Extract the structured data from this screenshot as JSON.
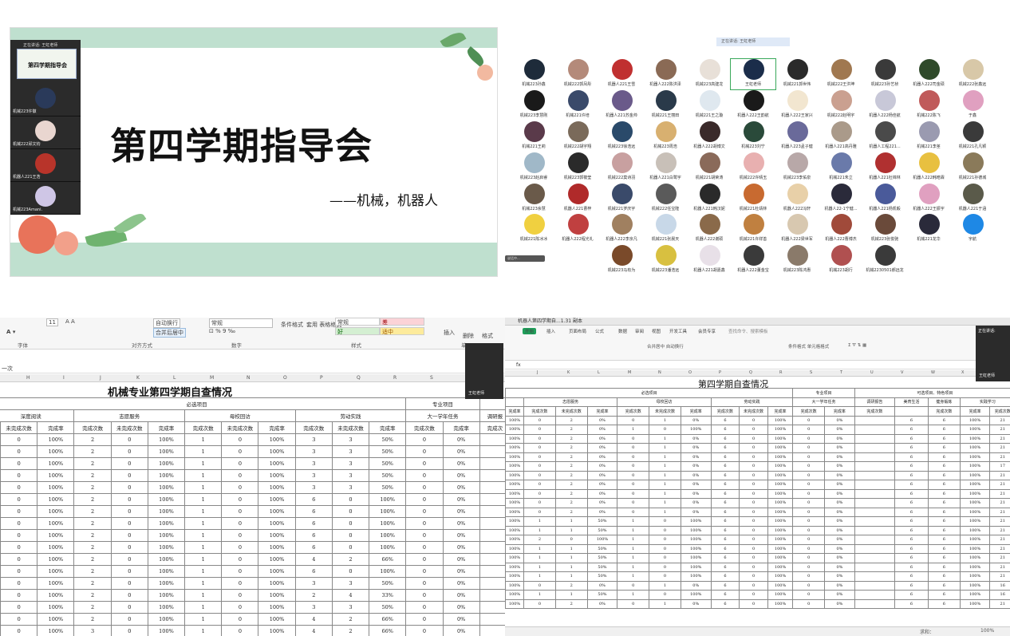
{
  "slide": {
    "title": "第四学期指导会",
    "subtitle": "——机械，机器人",
    "thumb_title": "第四学期指导会"
  },
  "video_strip": {
    "speaking_caption": "正在讲话: 王虹老师",
    "tiles": [
      {
        "name": "机械223许徽",
        "color": "#2a3a5a"
      },
      {
        "name": "机械222邱文钧",
        "color": "#e9d6d0"
      },
      {
        "name": "机器人221王浩",
        "color": "#b8342a"
      },
      {
        "name": "机械223Amani.",
        "color": "#cfc6e6"
      }
    ]
  },
  "gallery": {
    "header": "正在讲话: 王虹老师",
    "bottom_button": "说话中...",
    "participants": [
      {
        "name": "机械223孙鑫",
        "color": "#1e2b3a"
      },
      {
        "name": "机械222郭凤彤",
        "color": "#b48a7a"
      },
      {
        "name": "机器人221王雪",
        "color": "#c03030"
      },
      {
        "name": "机器人222陈洪泽",
        "color": "#8a6a55"
      },
      {
        "name": "机械223高建龙",
        "color": "#e8e0d8"
      },
      {
        "name": "王虹老师",
        "color": "#1b2d4a"
      },
      {
        "name": "机械221郭世伟",
        "color": "#2a2a2a"
      },
      {
        "name": "机械222王洪坤",
        "color": "#a07850"
      },
      {
        "name": "机械223孙艺桢",
        "color": "#3a3a3a"
      },
      {
        "name": "机器人222司金硕",
        "color": "#2f4a2a"
      },
      {
        "name": "机械222张鑫远",
        "color": "#d8c8a8"
      },
      {
        "name": "机械223李慧刚",
        "color": "#1a1a1a"
      },
      {
        "name": "机械221许培",
        "color": "#3a4a6a"
      },
      {
        "name": "机器人221苏金帅",
        "color": "#6a5a8a"
      },
      {
        "name": "机械221王丽田",
        "color": "#2a3a4a"
      },
      {
        "name": "机械221王之璇",
        "color": "#dfe8ef"
      },
      {
        "name": "机器人222王韵航",
        "color": "#1a1a1a"
      },
      {
        "name": "机器人222王家兴",
        "color": "#f2e6d0"
      },
      {
        "name": "机械222赵明宇",
        "color": "#caa090"
      },
      {
        "name": "机器人222杨佳航",
        "color": "#c8c8d8"
      },
      {
        "name": "机械222陈飞",
        "color": "#c05a5a"
      },
      {
        "name": "于鑫",
        "color": "#e0a0c0"
      },
      {
        "name": "机械221王莉",
        "color": "#5a3a4a"
      },
      {
        "name": "机械222胡宇翔",
        "color": "#7a6a5a"
      },
      {
        "name": "机械223徐浩远",
        "color": "#2a4a6a"
      },
      {
        "name": "机械223周浩",
        "color": "#d8b070"
      },
      {
        "name": "机器人222胡博文",
        "color": "#3a2a2a"
      },
      {
        "name": "机械223刘宁",
        "color": "#2a4a3a"
      },
      {
        "name": "机器人223孟子健",
        "color": "#6a6a9a"
      },
      {
        "name": "机器人221高丹雅",
        "color": "#aa9a8a"
      },
      {
        "name": "机器人工程221...",
        "color": "#4a4a4a"
      },
      {
        "name": "机械221李茎",
        "color": "#9a9ab0"
      },
      {
        "name": "机械221孔凡颖",
        "color": "#3a3a3a"
      },
      {
        "name": "机械223赵启睿",
        "color": "#a0b8c8"
      },
      {
        "name": "机械223郭筱莹",
        "color": "#2a2a2a"
      },
      {
        "name": "机械222莫诗羽",
        "color": "#c8a0a0"
      },
      {
        "name": "机器人221白鹭宇",
        "color": "#c8c0b8"
      },
      {
        "name": "机械221胡荣涛",
        "color": "#8a6a5a"
      },
      {
        "name": "机械222许晴玉",
        "color": "#e8b0b0"
      },
      {
        "name": "机械223李佑泉",
        "color": "#b8a8a8"
      },
      {
        "name": "机械221朱立",
        "color": "#6a7aaa"
      },
      {
        "name": "机器人221杜锦林",
        "color": "#b03030"
      },
      {
        "name": "机器人222韩皓霖",
        "color": "#e8c040"
      },
      {
        "name": "机械221孙德城",
        "color": "#8a7a5a"
      },
      {
        "name": "机械223余慧",
        "color": "#6a5a4a"
      },
      {
        "name": "机器人221曹梓",
        "color": "#b02a2a"
      },
      {
        "name": "机械221罗庆宇",
        "color": "#3a4a6a"
      },
      {
        "name": "机械222任宝隆",
        "color": "#5a5a5a"
      },
      {
        "name": "机器人221韩汉妮",
        "color": "#2a2a2a"
      },
      {
        "name": "机械221杜靖林",
        "color": "#c86a30"
      },
      {
        "name": "机器人222冯轩",
        "color": "#e8d0a8"
      },
      {
        "name": "机器人22-1宁健...",
        "color": "#2a2a3a"
      },
      {
        "name": "机器人221杨凯毅",
        "color": "#4a5a9a"
      },
      {
        "name": "机器人222王振宇",
        "color": "#e0a0c0"
      },
      {
        "name": "机器人221于涵",
        "color": "#5a5a4a"
      },
      {
        "name": "机械221陈冰冰",
        "color": "#f0d040"
      },
      {
        "name": "机器人222程光礼",
        "color": "#c04040"
      },
      {
        "name": "机器人222李京凡",
        "color": "#a08060"
      },
      {
        "name": "机械221张晨天",
        "color": "#c8d8e8"
      },
      {
        "name": "机器人222谢硕",
        "color": "#8a6a4a"
      },
      {
        "name": "机械221许祥善",
        "color": "#c08040"
      },
      {
        "name": "机器人222梁世军",
        "color": "#d8c8b0"
      },
      {
        "name": "机器人222曹博杰",
        "color": "#a04a3a"
      },
      {
        "name": "机械223张俊驰",
        "color": "#6a4a3a"
      },
      {
        "name": "机械221龙华",
        "color": "#2a2a3a"
      },
      {
        "name": "宇航",
        "color": "#1e88e5"
      },
      {
        "name": "机械223马有为",
        "color": "#7a4a2a"
      },
      {
        "name": "机械223潘浩远",
        "color": "#d8c040"
      },
      {
        "name": "机器人221胡嘉鑫",
        "color": "#e8e0e8"
      },
      {
        "name": "机器人222董金宝",
        "color": "#3a3a3a"
      },
      {
        "name": "机械223陈鸿惠",
        "color": "#8a7a6a"
      },
      {
        "name": "机械223胡行",
        "color": "#b05050"
      },
      {
        "name": "机械2230501郝远龙",
        "color": "#3a3a3a"
      }
    ]
  },
  "excel_left": {
    "ribbon": {
      "font_size": "11",
      "auto_wrap": "自动换行",
      "merge_center": "合并后居中",
      "number_format": "常规",
      "style_normal": "常规",
      "style_bad": "差",
      "style_good": "好",
      "style_neutral": "适中",
      "cond_format": "条件格式",
      "table_format": "套用\n表格格式",
      "insert": "插入",
      "delete": "删除",
      "format": "格式",
      "grp_font": "字体",
      "grp_align": "对齐方式",
      "grp_number": "数字",
      "grp_style": "样式",
      "grp_cell": "单"
    },
    "formula_text": "一次",
    "col_letters": [
      "H",
      "I",
      "J",
      "K",
      "L",
      "M",
      "N",
      "O",
      "P",
      "Q",
      "R",
      "S",
      "T"
    ],
    "title": "机械专业第四学期自查情况",
    "h1_required": "必选项目",
    "h1_major": "专业项目",
    "groups": [
      "深度阅读",
      "志愿服务",
      "母校回访",
      "劳动实践",
      "大一学年任务",
      "调研报"
    ],
    "sub": [
      "未完成次数",
      "完成率",
      "完成次数",
      "未完成次数",
      "完成率",
      "完成次数",
      "未完成次数",
      "完成率",
      "完成次数",
      "未完成次数",
      "完成率",
      "完成次数",
      "完成率",
      "完成次"
    ],
    "rows": [
      [
        "0",
        "100%",
        "2",
        "0",
        "100%",
        "1",
        "0",
        "100%",
        "3",
        "3",
        "50%",
        "0",
        "0%",
        ""
      ],
      [
        "0",
        "100%",
        "2",
        "0",
        "100%",
        "1",
        "0",
        "100%",
        "3",
        "3",
        "50%",
        "0",
        "0%",
        ""
      ],
      [
        "0",
        "100%",
        "2",
        "0",
        "100%",
        "1",
        "0",
        "100%",
        "3",
        "3",
        "50%",
        "0",
        "0%",
        ""
      ],
      [
        "0",
        "100%",
        "2",
        "0",
        "100%",
        "1",
        "0",
        "100%",
        "3",
        "3",
        "50%",
        "0",
        "0%",
        ""
      ],
      [
        "0",
        "100%",
        "2",
        "0",
        "100%",
        "1",
        "0",
        "100%",
        "3",
        "3",
        "50%",
        "0",
        "0%",
        ""
      ],
      [
        "0",
        "100%",
        "2",
        "0",
        "100%",
        "1",
        "0",
        "100%",
        "6",
        "0",
        "100%",
        "0",
        "0%",
        ""
      ],
      [
        "0",
        "100%",
        "2",
        "0",
        "100%",
        "1",
        "0",
        "100%",
        "6",
        "0",
        "100%",
        "0",
        "0%",
        ""
      ],
      [
        "0",
        "100%",
        "2",
        "0",
        "100%",
        "1",
        "0",
        "100%",
        "6",
        "0",
        "100%",
        "0",
        "0%",
        ""
      ],
      [
        "0",
        "100%",
        "2",
        "0",
        "100%",
        "1",
        "0",
        "100%",
        "6",
        "0",
        "100%",
        "0",
        "0%",
        ""
      ],
      [
        "0",
        "100%",
        "2",
        "0",
        "100%",
        "1",
        "0",
        "100%",
        "6",
        "0",
        "100%",
        "0",
        "0%",
        ""
      ],
      [
        "0",
        "100%",
        "2",
        "0",
        "100%",
        "1",
        "0",
        "100%",
        "4",
        "2",
        "66%",
        "0",
        "0%",
        ""
      ],
      [
        "0",
        "100%",
        "2",
        "0",
        "100%",
        "1",
        "0",
        "100%",
        "6",
        "0",
        "100%",
        "0",
        "0%",
        ""
      ],
      [
        "0",
        "100%",
        "2",
        "0",
        "100%",
        "1",
        "0",
        "100%",
        "3",
        "3",
        "50%",
        "0",
        "0%",
        ""
      ],
      [
        "0",
        "100%",
        "2",
        "0",
        "100%",
        "1",
        "0",
        "100%",
        "2",
        "4",
        "33%",
        "0",
        "0%",
        ""
      ],
      [
        "0",
        "100%",
        "2",
        "0",
        "100%",
        "1",
        "0",
        "100%",
        "3",
        "3",
        "50%",
        "0",
        "0%",
        ""
      ],
      [
        "0",
        "100%",
        "2",
        "0",
        "100%",
        "1",
        "0",
        "100%",
        "4",
        "2",
        "66%",
        "0",
        "0%",
        ""
      ],
      [
        "0",
        "100%",
        "3",
        "0",
        "100%",
        "1",
        "0",
        "100%",
        "4",
        "2",
        "66%",
        "0",
        "0%",
        ""
      ]
    ],
    "presenter_label": "王虹老师"
  },
  "excel_right": {
    "tab_title": "机器人第四学期自...1.31 副本",
    "tabs": [
      "开始",
      "插入",
      "页面布局",
      "公式",
      "数据",
      "审阅",
      "视图",
      "开发工具",
      "会员专享"
    ],
    "search": "查找命令、搜索模板",
    "formula_label": "fx",
    "title": "第四学期自查情况",
    "speaking": "正在讲话:",
    "presenter_label": "王虹老师",
    "col_letters": [
      "J",
      "K",
      "L",
      "M",
      "N",
      "O",
      "P",
      "Q",
      "R",
      "S",
      "T",
      "U",
      "V",
      "W",
      "X"
    ],
    "h1": [
      "必选项目",
      "专业项目",
      "可选项目、特色项目"
    ],
    "groups": [
      "志愿服务",
      "母校回访",
      "劳动实践",
      "大一学年任务",
      "调研报告",
      "美育生活",
      "健身锻炼",
      "实践学习"
    ],
    "sub": [
      "完成率",
      "完成次数",
      "未完成次数",
      "完成率",
      "完成次数",
      "未完成次数",
      "完成率",
      "完成次数",
      "未完成次数",
      "完成率",
      "完成次数",
      "完成率",
      "完成次数",
      "",
      "完成次数",
      "完成率",
      "完成次数"
    ],
    "rows": [
      [
        "100%",
        "0",
        "2",
        "0%",
        "0",
        "1",
        "0%",
        "6",
        "0",
        "100%",
        "0",
        "0%",
        "",
        "6",
        "6",
        "100%",
        "21"
      ],
      [
        "100%",
        "0",
        "2",
        "0%",
        "1",
        "0",
        "100%",
        "6",
        "0",
        "100%",
        "0",
        "0%",
        "",
        "6",
        "6",
        "100%",
        "21"
      ],
      [
        "100%",
        "0",
        "2",
        "0%",
        "0",
        "1",
        "0%",
        "6",
        "0",
        "100%",
        "0",
        "0%",
        "",
        "6",
        "6",
        "100%",
        "21"
      ],
      [
        "100%",
        "0",
        "2",
        "0%",
        "0",
        "1",
        "0%",
        "6",
        "0",
        "100%",
        "0",
        "0%",
        "",
        "6",
        "6",
        "100%",
        "21"
      ],
      [
        "100%",
        "0",
        "2",
        "0%",
        "0",
        "1",
        "0%",
        "6",
        "0",
        "100%",
        "0",
        "0%",
        "",
        "6",
        "6",
        "100%",
        "21"
      ],
      [
        "100%",
        "0",
        "2",
        "0%",
        "0",
        "1",
        "0%",
        "6",
        "0",
        "100%",
        "0",
        "0%",
        "",
        "6",
        "6",
        "100%",
        "17"
      ],
      [
        "100%",
        "0",
        "2",
        "0%",
        "0",
        "1",
        "0%",
        "6",
        "0",
        "100%",
        "0",
        "0%",
        "",
        "6",
        "6",
        "100%",
        "21"
      ],
      [
        "100%",
        "0",
        "2",
        "0%",
        "0",
        "1",
        "0%",
        "6",
        "0",
        "100%",
        "0",
        "0%",
        "",
        "6",
        "6",
        "100%",
        "21"
      ],
      [
        "100%",
        "0",
        "2",
        "0%",
        "0",
        "1",
        "0%",
        "6",
        "0",
        "100%",
        "0",
        "0%",
        "",
        "6",
        "6",
        "100%",
        "21"
      ],
      [
        "100%",
        "0",
        "2",
        "0%",
        "0",
        "1",
        "0%",
        "6",
        "0",
        "100%",
        "0",
        "0%",
        "",
        "6",
        "6",
        "100%",
        "21"
      ],
      [
        "100%",
        "0",
        "2",
        "0%",
        "0",
        "1",
        "0%",
        "6",
        "0",
        "100%",
        "0",
        "0%",
        "",
        "6",
        "6",
        "100%",
        "21"
      ],
      [
        "100%",
        "1",
        "1",
        "50%",
        "1",
        "0",
        "100%",
        "6",
        "0",
        "100%",
        "0",
        "0%",
        "",
        "6",
        "6",
        "100%",
        "21"
      ],
      [
        "100%",
        "1",
        "1",
        "50%",
        "1",
        "0",
        "100%",
        "6",
        "0",
        "100%",
        "0",
        "0%",
        "",
        "6",
        "6",
        "100%",
        "21"
      ],
      [
        "100%",
        "2",
        "0",
        "100%",
        "1",
        "0",
        "100%",
        "6",
        "0",
        "100%",
        "0",
        "0%",
        "",
        "6",
        "6",
        "100%",
        "21"
      ],
      [
        "100%",
        "1",
        "1",
        "50%",
        "1",
        "0",
        "100%",
        "6",
        "0",
        "100%",
        "0",
        "0%",
        "",
        "6",
        "6",
        "100%",
        "21"
      ],
      [
        "100%",
        "1",
        "1",
        "50%",
        "1",
        "0",
        "100%",
        "6",
        "0",
        "100%",
        "0",
        "0%",
        "",
        "6",
        "6",
        "100%",
        "21"
      ],
      [
        "100%",
        "1",
        "1",
        "50%",
        "1",
        "0",
        "100%",
        "6",
        "0",
        "100%",
        "0",
        "0%",
        "",
        "6",
        "6",
        "100%",
        "21"
      ],
      [
        "100%",
        "1",
        "1",
        "50%",
        "1",
        "0",
        "100%",
        "6",
        "0",
        "100%",
        "0",
        "0%",
        "",
        "6",
        "6",
        "100%",
        "21"
      ],
      [
        "100%",
        "0",
        "2",
        "0%",
        "0",
        "1",
        "0%",
        "6",
        "0",
        "100%",
        "0",
        "0%",
        "",
        "6",
        "6",
        "100%",
        "16"
      ],
      [
        "100%",
        "1",
        "1",
        "50%",
        "1",
        "0",
        "100%",
        "6",
        "0",
        "100%",
        "0",
        "0%",
        "",
        "6",
        "6",
        "100%",
        "16"
      ],
      [
        "100%",
        "0",
        "2",
        "0%",
        "0",
        "1",
        "0%",
        "6",
        "0",
        "100%",
        "0",
        "0%",
        "",
        "6",
        "6",
        "100%",
        "21"
      ]
    ],
    "status_text": "求和：",
    "zoom": "100%"
  }
}
